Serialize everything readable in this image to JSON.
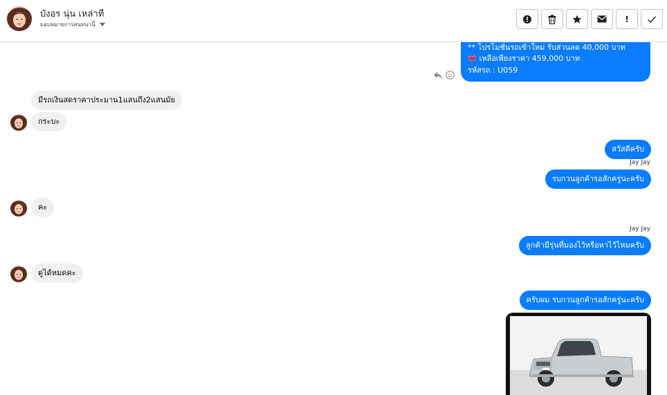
{
  "header": {
    "contact_name": "บังอร นุ่น เหล่าที",
    "assign_label": "มอบหมายการสนทนานี้"
  },
  "toolbar": {
    "spam_label": "!",
    "check_label": "✓"
  },
  "messages": {
    "promo_line1": "** โปรโมชั่นรถเข้าใหม่ รับส่วนลด 40,000 บาท",
    "promo_line2": "เหลือเพียงราคา 459,000 บาท",
    "promo_line3": "รหัสรถ : U059",
    "in1": "มีรถเงินสดราคาประมาน1แสนถึง2แสนมัย",
    "in2": "กระบะ",
    "out1": "สวัสดีครับ",
    "sender1": "Jay Jay",
    "out2": "รบกวนลูกค้ารอสักครู่นะครับ",
    "in3": "คะ",
    "sender2": "Jay Jay",
    "out3": "ลูกค้ามีรุ่นที่มองไว้หรือหาไว้ไหมครับ",
    "in4": "ดูได้หมดคะ",
    "out4": "ครับผม รบกวนลูกค้ารอสักครู่นะครับ"
  },
  "colors": {
    "outgoing_bubble": "#0a7cff",
    "incoming_bubble": "#f0f0f0"
  },
  "icons": [
    "alert-circle-icon",
    "trash-icon",
    "star-icon",
    "envelope-icon",
    "exclamation-icon",
    "check-icon",
    "reply-icon",
    "emoji-icon",
    "caret-down-icon"
  ]
}
